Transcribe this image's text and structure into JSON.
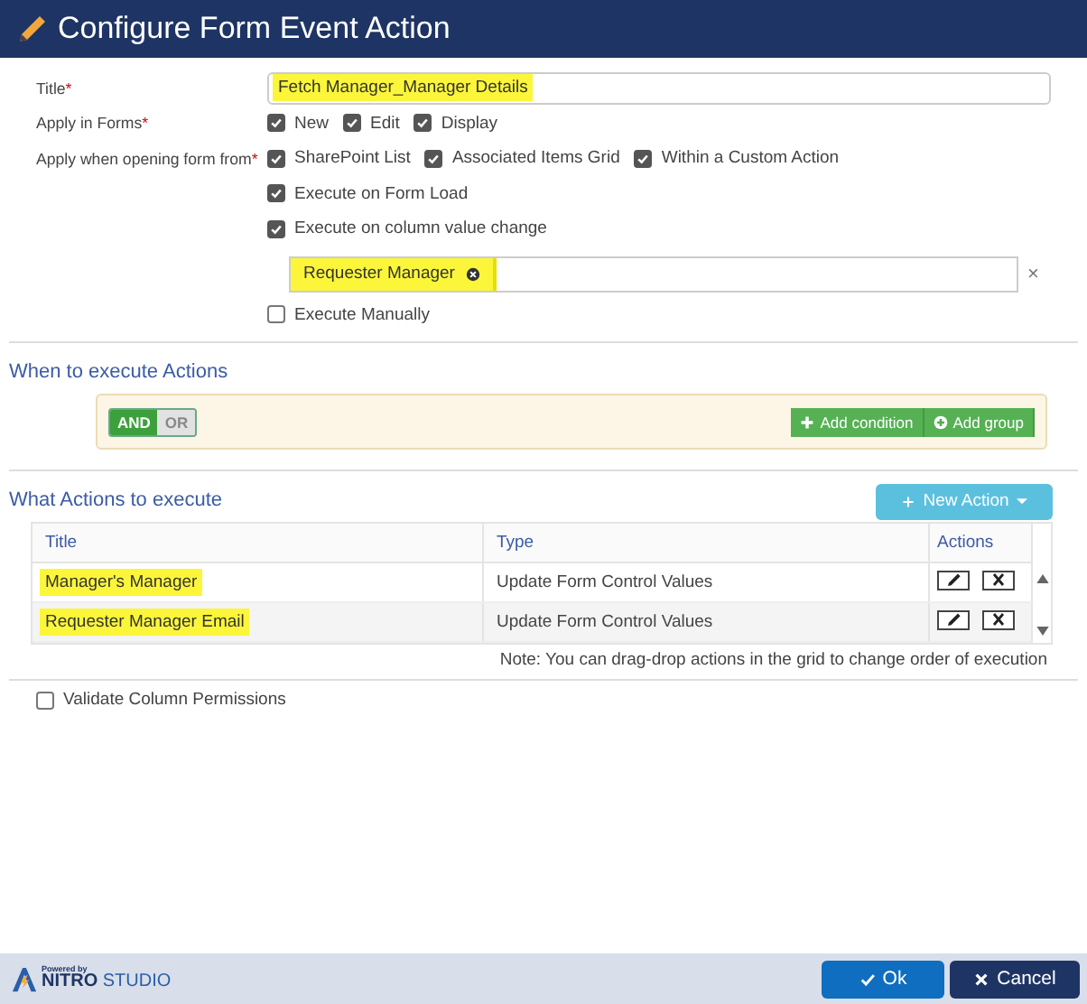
{
  "window": {
    "title": "Configure Form Event Action"
  },
  "form": {
    "title": {
      "label": "Title",
      "required_mark": "*",
      "value": "Fetch Manager_Manager Details",
      "highlighted": true
    },
    "apply_in_forms": {
      "label": "Apply in Forms",
      "required_mark": "*",
      "options": [
        {
          "label": "New",
          "checked": true
        },
        {
          "label": "Edit",
          "checked": true
        },
        {
          "label": "Display",
          "checked": true
        }
      ]
    },
    "apply_when_opening": {
      "label": "Apply when opening form from",
      "required_mark": "*",
      "options": [
        {
          "label": "SharePoint List",
          "checked": true
        },
        {
          "label": "Associated Items Grid",
          "checked": true
        },
        {
          "label": "Within a Custom Action",
          "checked": true
        }
      ]
    },
    "execute_on_form_load": {
      "label": "Execute on Form Load",
      "checked": true
    },
    "execute_on_column_change": {
      "label": "Execute on column value change",
      "checked": true
    },
    "columns_field": {
      "tags": [
        {
          "label": "Requester Manager",
          "highlighted": true
        }
      ],
      "clear": "×"
    },
    "execute_manually": {
      "label": "Execute Manually",
      "checked": false
    }
  },
  "when_section": {
    "heading": "When to execute Actions",
    "logic": [
      {
        "label": "AND",
        "selected": true
      },
      {
        "label": "OR",
        "selected": false
      }
    ],
    "buttons": [
      "Add condition",
      "Add group"
    ]
  },
  "actions_section": {
    "heading": "What Actions to execute",
    "new_action": "New Action",
    "columns": [
      "Title",
      "Type",
      "Actions"
    ],
    "rows": [
      {
        "title": "Manager's Manager",
        "type": "Update Form Control Values",
        "highlighted": true
      },
      {
        "title": "Requester Manager Email",
        "type": "Update Form Control Values",
        "highlighted": true
      }
    ],
    "note": "Note: You can drag-drop actions in the grid to change order of execution"
  },
  "validate_permissions": {
    "label": "Validate Column Permissions",
    "checked": false
  },
  "footer": {
    "logo": {
      "powered": "Powered by",
      "brand": "NITRO",
      "product": "STUDIO"
    },
    "buttons": [
      {
        "label": "Ok",
        "kind": "ok"
      },
      {
        "label": "Cancel",
        "kind": "cancel"
      }
    ]
  }
}
